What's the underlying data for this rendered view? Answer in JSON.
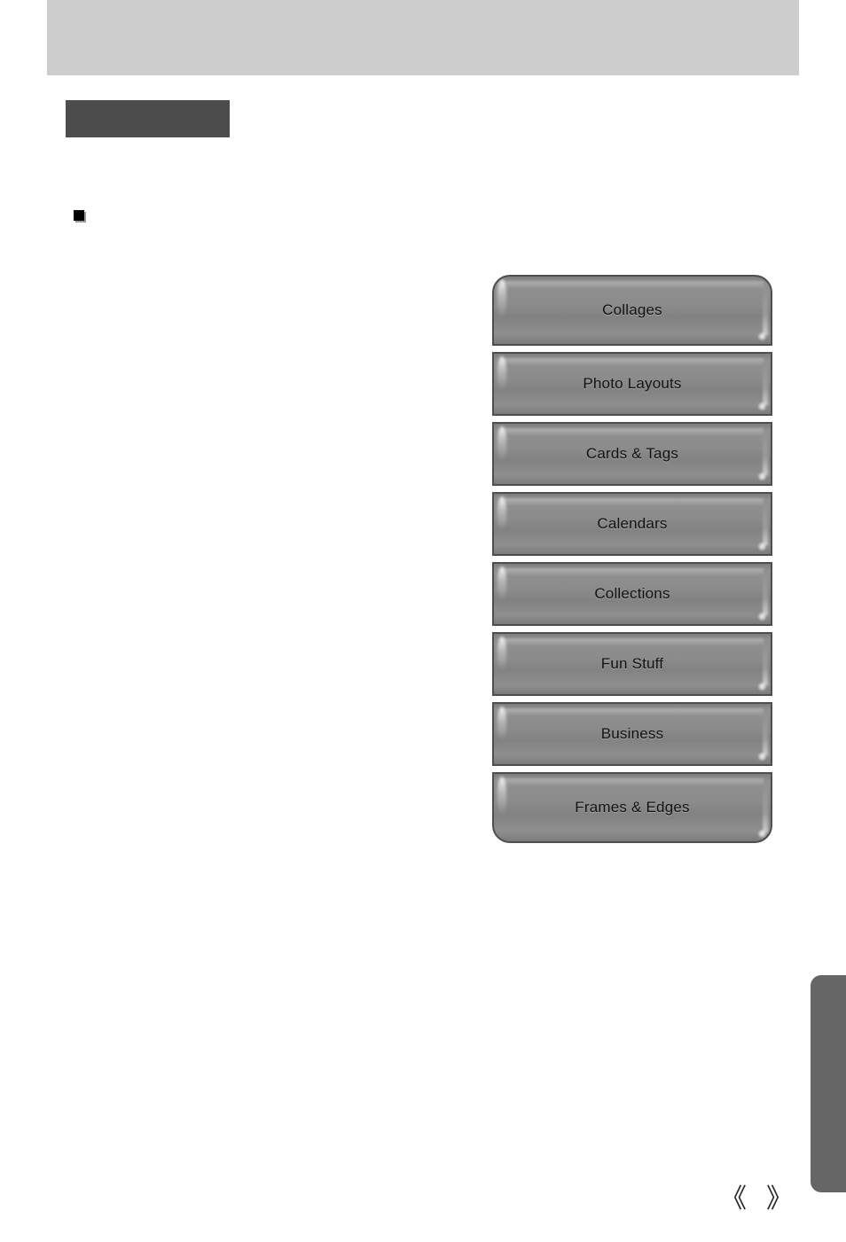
{
  "page": {
    "header_title": "",
    "section_heading": "",
    "bullet_text": "",
    "body_copy": "",
    "page_number": "",
    "colors": {
      "header_band": "#cdcdcd",
      "section_block": "#4c4c4c",
      "side_tab": "#666666",
      "button_face": "#8b8b8b",
      "button_border": "#4e4e4e",
      "bullet": "#000000",
      "label_text": "#111111"
    }
  },
  "button_panel": {
    "name": "template-category-panel",
    "buttons": [
      {
        "label": "Collages"
      },
      {
        "label": "Photo Layouts"
      },
      {
        "label": "Cards & Tags"
      },
      {
        "label": "Calendars"
      },
      {
        "label": "Collections"
      },
      {
        "label": "Fun Stuff"
      },
      {
        "label": "Business"
      },
      {
        "label": "Frames & Edges"
      }
    ]
  },
  "side_tab": {
    "label": ""
  },
  "footer": {
    "prev_glyph": "《",
    "next_glyph": "》"
  }
}
